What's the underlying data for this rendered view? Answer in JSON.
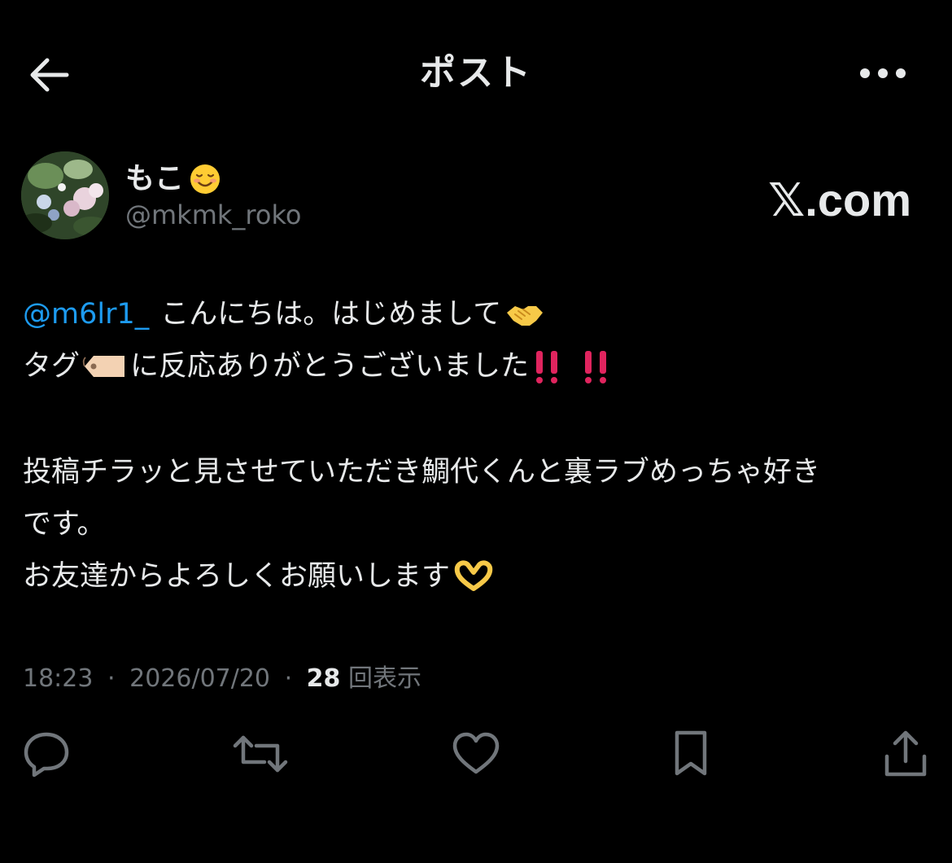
{
  "header": {
    "title": "ポスト",
    "back_icon": "arrow-left-icon",
    "more_icon": "more-horizontal-icon"
  },
  "author": {
    "display_name": "もこ",
    "display_name_emoji": "smiling-face-emoji",
    "handle": "@mkmk_roko",
    "avatar": "flower-photo-avatar"
  },
  "watermark": "𝕏.com",
  "tweet": {
    "mention": "@m6lr1_",
    "line1_text": "こんにちは。はじめまして",
    "line1_emoji": "handshake-emoji",
    "line2_text_a": "タグ",
    "line2_emoji_tag": "label-tag-emoji",
    "line2_text_b": "に反応ありがとうございました",
    "line2_emoji_end": "double-exclamation-emoji",
    "line3_text": "投稿チラッと見させていただき鯛代くんと裏ラブめっちゃ好き",
    "line4_text": "です。",
    "line5_text": "お友達からよろしくお願いします",
    "line5_emoji": "heart-hands-emoji"
  },
  "meta": {
    "time": "18:23",
    "date": "2026/07/20",
    "separator": "·",
    "views_count": "28",
    "views_label": "回表示"
  },
  "actions": {
    "reply_icon": "reply-icon",
    "repost_icon": "repost-icon",
    "like_icon": "like-heart-icon",
    "bookmark_icon": "bookmark-icon",
    "share_icon": "share-icon"
  },
  "colors": {
    "background": "#000000",
    "text": "#e7e9ea",
    "secondary": "#71767b",
    "link": "#1d9bf0",
    "exclamation": "#e0245e"
  }
}
